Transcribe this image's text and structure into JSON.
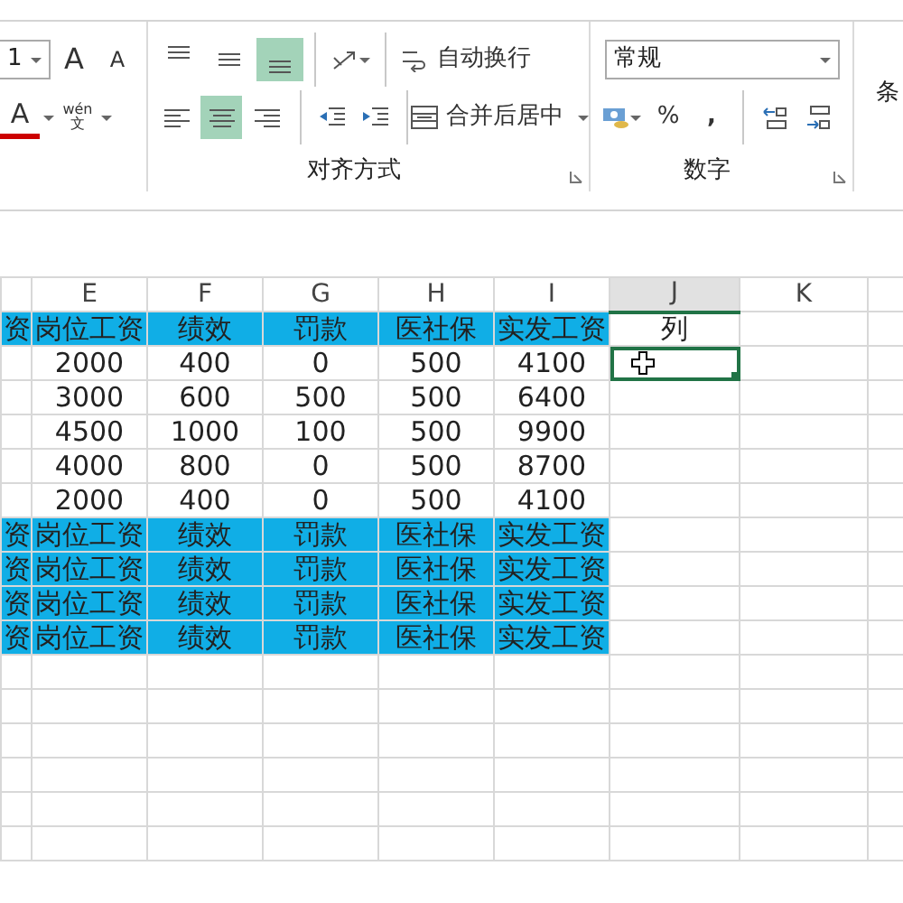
{
  "ribbon": {
    "font_group": {
      "font_size": "1",
      "grow_label": "A",
      "shrink_label": "A",
      "font_color_label": "A",
      "phonetic": [
        "wén",
        "文"
      ]
    },
    "alignment_group": {
      "title": "对齐方式",
      "vertical_buttons": [
        {
          "kind": "top",
          "selected": false
        },
        {
          "kind": "middle",
          "selected": false
        },
        {
          "kind": "bottom",
          "selected": true
        }
      ],
      "horizontal_buttons": [
        {
          "kind": "left",
          "selected": false
        },
        {
          "kind": "center",
          "selected": true
        },
        {
          "kind": "right",
          "selected": false
        }
      ],
      "wrap_text": "自动换行",
      "merge_center": "合并后居中"
    },
    "number_group": {
      "title": "数字",
      "format": "常规",
      "percent": "%",
      "comma": ","
    },
    "next_group_label": "条"
  },
  "sheet": {
    "columns": [
      {
        "label": "E",
        "selected": false
      },
      {
        "label": "F",
        "selected": false
      },
      {
        "label": "G",
        "selected": false
      },
      {
        "label": "H",
        "selected": false
      },
      {
        "label": "I",
        "selected": false
      },
      {
        "label": "J",
        "selected": true
      },
      {
        "label": "K",
        "selected": false
      }
    ],
    "rows": [
      {
        "kind": "header",
        "partial": "资",
        "cells": [
          "岗位工资",
          "绩效",
          "罚款",
          "医社保",
          "实发工资"
        ],
        "j_text": "列",
        "j_active": false
      },
      {
        "kind": "data",
        "cells": [
          "2000",
          "400",
          "0",
          "500",
          "4100"
        ],
        "j_active": true
      },
      {
        "kind": "data",
        "cells": [
          "3000",
          "600",
          "500",
          "500",
          "6400"
        ],
        "j_active": false
      },
      {
        "kind": "data",
        "cells": [
          "4500",
          "1000",
          "100",
          "500",
          "9900"
        ],
        "j_active": false
      },
      {
        "kind": "data",
        "cells": [
          "4000",
          "800",
          "0",
          "500",
          "8700"
        ],
        "j_active": false
      },
      {
        "kind": "data",
        "cells": [
          "2000",
          "400",
          "0",
          "500",
          "4100"
        ],
        "j_active": false
      },
      {
        "kind": "header",
        "partial": "资",
        "cells": [
          "岗位工资",
          "绩效",
          "罚款",
          "医社保",
          "实发工资"
        ],
        "j_active": false
      },
      {
        "kind": "header",
        "partial": "资",
        "cells": [
          "岗位工资",
          "绩效",
          "罚款",
          "医社保",
          "实发工资"
        ],
        "j_active": false
      },
      {
        "kind": "header",
        "partial": "资",
        "cells": [
          "岗位工资",
          "绩效",
          "罚款",
          "医社保",
          "实发工资"
        ],
        "j_active": false
      },
      {
        "kind": "header",
        "partial": "资",
        "cells": [
          "岗位工资",
          "绩效",
          "罚款",
          "医社保",
          "实发工资"
        ],
        "j_active": false
      }
    ]
  }
}
